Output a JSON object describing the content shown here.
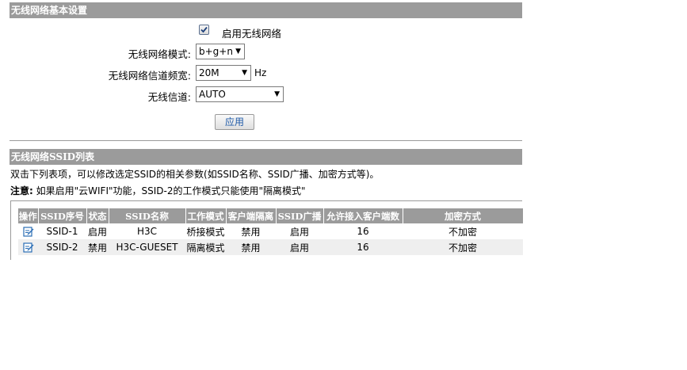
{
  "basic_settings": {
    "title": "无线网络基本设置",
    "enable_wireless_label": "启用无线网络",
    "enable_wireless_checked": true,
    "mode_label": "无线网络模式:",
    "mode_value": "b+g+n",
    "bandwidth_label": "无线网络信道频宽:",
    "bandwidth_value": "20M",
    "bandwidth_unit": "Hz",
    "channel_label": "无线信道:",
    "channel_value": "AUTO",
    "apply_button": "应用"
  },
  "ssid_list": {
    "title": "无线网络SSID列表",
    "hint": "双击下列表项，可以修改选定SSID的相关参数(如SSID名称、SSID广播、加密方式等)。",
    "note_label": "注意:",
    "note_text": " 如果启用\"云WIFI\"功能，SSID-2的工作模式只能使用\"隔离模式\"",
    "columns": [
      "操作",
      "SSID序号",
      "状态",
      "SSID名称",
      "工作模式",
      "客户端隔离",
      "SSID广播",
      "允许接入客户端数",
      "加密方式"
    ],
    "rows": [
      [
        "",
        "SSID-1",
        "启用",
        "H3C",
        "桥接模式",
        "禁用",
        "启用",
        "16",
        "不加密"
      ],
      [
        "",
        "SSID-2",
        "禁用",
        "H3C-GUESET",
        "隔离模式",
        "禁用",
        "启用",
        "16",
        "不加密"
      ]
    ]
  },
  "icons": {
    "edit": "edit-icon",
    "check": "checkmark-icon",
    "dropdown": "triangle-down-icon"
  },
  "colors": {
    "section_bar": "#9b9b9b",
    "apply_text": "#1f5aa8",
    "edit_icon": "#2a6db5"
  }
}
